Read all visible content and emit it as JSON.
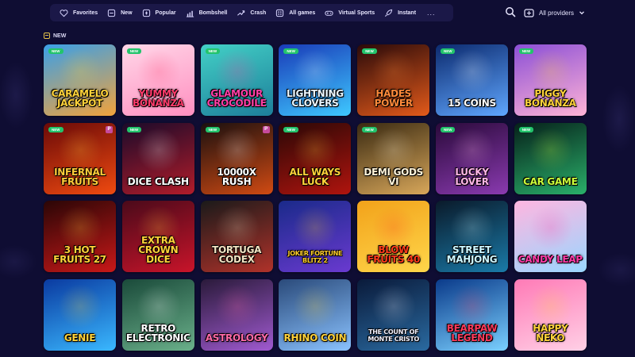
{
  "categories": [
    {
      "label": "Favorites",
      "icon": "heart-icon"
    },
    {
      "label": "New",
      "icon": "new-icon"
    },
    {
      "label": "Popular",
      "icon": "popular-icon"
    },
    {
      "label": "Bombshell",
      "icon": "bombshell-icon"
    },
    {
      "label": "Crash",
      "icon": "crash-icon"
    },
    {
      "label": "All games",
      "icon": "all-games-icon"
    },
    {
      "label": "Virtual Sports",
      "icon": "gamepad-icon"
    },
    {
      "label": "Instant",
      "icon": "rocket-icon"
    }
  ],
  "more_label": "...",
  "providers_label": "All providers",
  "section_title": "NEW",
  "new_badge": "NEW",
  "provider_mark": "P",
  "colors": {
    "background": "#0f0d33",
    "topbar": "#1b1848",
    "badge": "#23c46c",
    "accent": "#e6c24a"
  },
  "games": [
    {
      "title": "Caramelo Jackpot",
      "bg": [
        "#3aa0e8",
        "#f2a23b"
      ],
      "fg": "#ffd23a",
      "badge": true,
      "p": false
    },
    {
      "title": "Yummy Bonanza",
      "bg": [
        "#ffd7e8",
        "#ff8fc0"
      ],
      "fg": "#ff3b6b",
      "badge": true,
      "p": false
    },
    {
      "title": "Glamour Crocodile",
      "bg": [
        "#43d0c6",
        "#1d7e9a"
      ],
      "fg": "#ff3fa6",
      "badge": true,
      "p": false
    },
    {
      "title": "Lightning Clovers",
      "bg": [
        "#1a3bb8",
        "#3ec8ff"
      ],
      "fg": "#eaf6ff",
      "badge": true,
      "p": false
    },
    {
      "title": "Hades Power",
      "bg": [
        "#2a0a0a",
        "#e35a1a"
      ],
      "fg": "#ff8a3a",
      "badge": true,
      "p": false
    },
    {
      "title": "15 Coins",
      "bg": [
        "#0c2a6e",
        "#5fa6ff"
      ],
      "fg": "#ffffff",
      "badge": true,
      "p": false
    },
    {
      "title": "Piggy Bonanza",
      "bg": [
        "#8b4fd6",
        "#ffb3d6"
      ],
      "fg": "#ffd23a",
      "badge": true,
      "p": false
    },
    {
      "title": "Infernal Fruits",
      "bg": [
        "#6a0a08",
        "#f04a10"
      ],
      "fg": "#ffcc3a",
      "badge": true,
      "p": true
    },
    {
      "title": "Dice Clash",
      "bg": [
        "#1a0a2a",
        "#b21c2a"
      ],
      "fg": "#ffffff",
      "badge": true,
      "p": false
    },
    {
      "title": "10000x Rush",
      "bg": [
        "#1a1010",
        "#d14a12"
      ],
      "fg": "#ffffff",
      "badge": true,
      "p": true
    },
    {
      "title": "All Ways Luck",
      "bg": [
        "#2a0806",
        "#b0140e"
      ],
      "fg": "#ffd23a",
      "badge": true,
      "p": false
    },
    {
      "title": "Demi Gods VI",
      "bg": [
        "#3a2a12",
        "#d8a75a"
      ],
      "fg": "#fff4da",
      "badge": true,
      "p": false
    },
    {
      "title": "Lucky Lover",
      "bg": [
        "#2a0a3a",
        "#8a3ab0"
      ],
      "fg": "#ffb6e6",
      "badge": true,
      "p": false
    },
    {
      "title": "Car Game",
      "bg": [
        "#06201a",
        "#2ab06a"
      ],
      "fg": "#ccff3a",
      "badge": true,
      "p": false
    },
    {
      "title": "3 Hot Fruits 27",
      "bg": [
        "#2a0606",
        "#c81818"
      ],
      "fg": "#ffd23a",
      "badge": false,
      "p": false
    },
    {
      "title": "Extra Crown Dice",
      "bg": [
        "#4a0a1a",
        "#c8142a"
      ],
      "fg": "#ffd23a",
      "badge": false,
      "p": false
    },
    {
      "title": "Tortuga Codex",
      "bg": [
        "#1a1a1a",
        "#b0322a"
      ],
      "fg": "#f2e2c2",
      "badge": false,
      "p": false
    },
    {
      "title": "Joker Fortune Blitz 2",
      "bg": [
        "#1a2a8a",
        "#6a3ad0"
      ],
      "fg": "#ffcc2a",
      "badge": false,
      "p": false
    },
    {
      "title": "Blow Fruits 40",
      "bg": [
        "#f2a21a",
        "#ffd64a"
      ],
      "fg": "#ff3a1a",
      "badge": false,
      "p": false
    },
    {
      "title": "Street Mahjong",
      "bg": [
        "#0a1a2a",
        "#1a7aa8"
      ],
      "fg": "#ccf6ff",
      "badge": false,
      "p": false
    },
    {
      "title": "Candy Leap",
      "bg": [
        "#ffb6e0",
        "#9ad6ff"
      ],
      "fg": "#ff3aa6",
      "badge": false,
      "p": false
    },
    {
      "title": "Genie",
      "bg": [
        "#0a3aa0",
        "#3ab8ff"
      ],
      "fg": "#ffd23a",
      "badge": false,
      "p": false
    },
    {
      "title": "Retro Electronic",
      "bg": [
        "#1a4a3a",
        "#6ab08a"
      ],
      "fg": "#ffffff",
      "badge": false,
      "p": false
    },
    {
      "title": "Astrology",
      "bg": [
        "#2a1a3a",
        "#a05ad0"
      ],
      "fg": "#ff6aa6",
      "badge": false,
      "p": false
    },
    {
      "title": "Rhino Coin",
      "bg": [
        "#2a4a7a",
        "#8ac2ff"
      ],
      "fg": "#ffd23a",
      "badge": false,
      "p": false
    },
    {
      "title": "The Count of Monte Cristo",
      "bg": [
        "#0a1a3a",
        "#2a6aa0"
      ],
      "fg": "#f2f2ff",
      "badge": false,
      "p": false
    },
    {
      "title": "Bearpaw Legend",
      "bg": [
        "#0a3a8a",
        "#7ad0ff"
      ],
      "fg": "#ff3a5a",
      "badge": false,
      "p": false
    },
    {
      "title": "Happy Neko",
      "bg": [
        "#ff7ab6",
        "#ffd0e6"
      ],
      "fg": "#ffd23a",
      "badge": false,
      "p": false
    }
  ]
}
